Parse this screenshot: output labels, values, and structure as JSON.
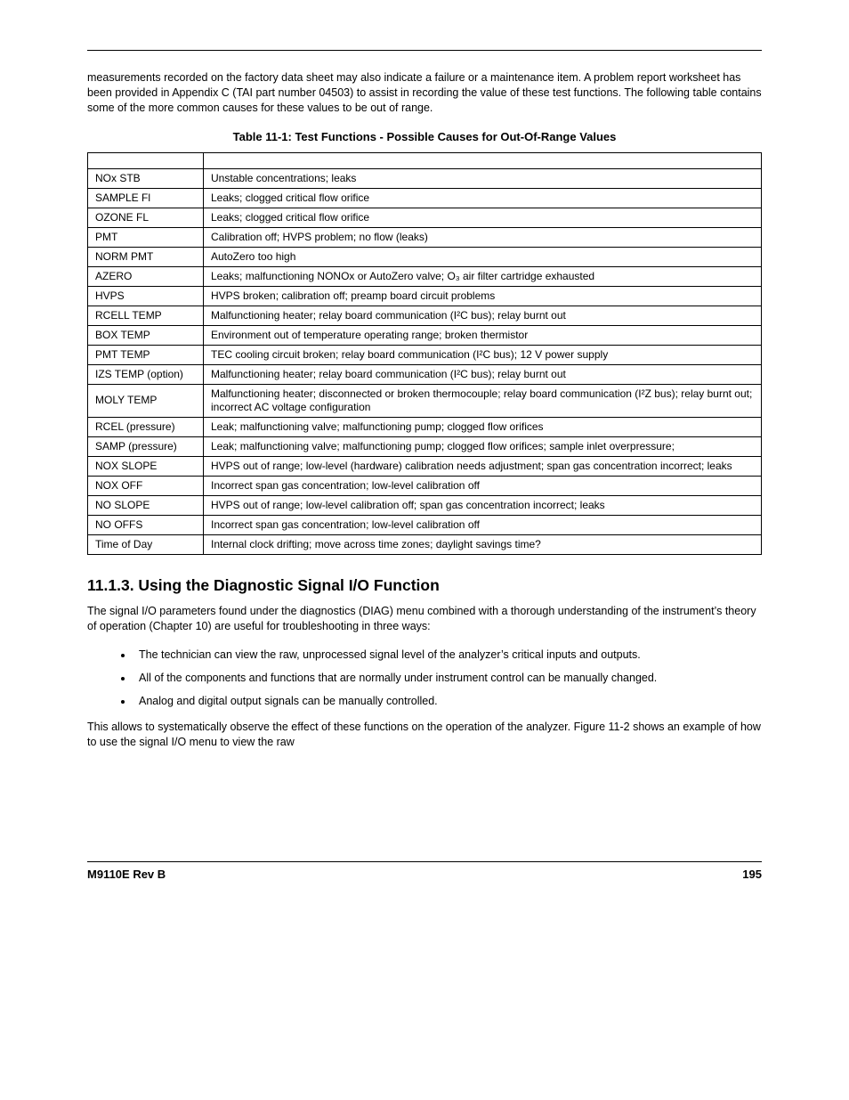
{
  "intro_paragraph": "measurements recorded on the factory data sheet may also indicate a failure or a maintenance item. A problem report worksheet has been provided in Appendix C (TAI part number 04503) to assist in recording the value of these test functions. The following table contains some of the more common causes for these values to be out of range.",
  "table_caption": "Table 11-1:  Test Functions - Possible Causes for Out-Of-Range Values",
  "table_rows": [
    {
      "name": "NOx STB",
      "cause": "Unstable concentrations; leaks"
    },
    {
      "name": "SAMPLE Fl",
      "cause": "Leaks; clogged critical flow orifice"
    },
    {
      "name": "OZONE FL",
      "cause": "Leaks; clogged critical flow orifice"
    },
    {
      "name": "PMT",
      "cause": "Calibration off; HVPS problem; no flow (leaks)"
    },
    {
      "name": "NORM PMT",
      "cause": "AutoZero too high"
    },
    {
      "name": "AZERO",
      "cause": "Leaks; malfunctioning NONOx or AutoZero valve; O₃ air filter cartridge exhausted"
    },
    {
      "name": "HVPS",
      "cause": "HVPS broken; calibration off; preamp board circuit problems"
    },
    {
      "name": "RCELL TEMP",
      "cause": "Malfunctioning heater; relay board communication (I²C bus); relay burnt out"
    },
    {
      "name": "BOX TEMP",
      "cause": "Environment out of temperature operating range; broken thermistor"
    },
    {
      "name": "PMT TEMP",
      "cause": "TEC cooling circuit broken; relay board communication (I²C bus); 12 V power supply"
    },
    {
      "name": "IZS TEMP (option)",
      "cause": "Malfunctioning heater; relay board communication (I²C bus); relay burnt out"
    },
    {
      "name": "MOLY TEMP",
      "cause": "Malfunctioning heater; disconnected or broken thermocouple; relay board communication (I²Z bus); relay burnt out; incorrect AC voltage configuration"
    },
    {
      "name": "RCEL (pressure)",
      "cause": "Leak; malfunctioning valve; malfunctioning pump; clogged flow orifices"
    },
    {
      "name": "SAMP (pressure)",
      "cause": "Leak; malfunctioning valve; malfunctioning pump; clogged flow orifices; sample inlet overpressure;"
    },
    {
      "name": "NOX SLOPE",
      "cause": "HVPS out of range; low-level (hardware) calibration needs adjustment; span gas concentration incorrect; leaks"
    },
    {
      "name": "NOX OFF",
      "cause": "Incorrect span gas concentration; low-level calibration off"
    },
    {
      "name": "NO SLOPE",
      "cause": "HVPS out of range; low-level calibration off; span gas concentration incorrect; leaks"
    },
    {
      "name": "NO OFFS",
      "cause": "Incorrect span gas concentration; low-level calibration off"
    },
    {
      "name": "Time of Day",
      "cause": "Internal clock drifting; move across time zones; daylight savings time?"
    }
  ],
  "section_heading": "11.1.3. Using the Diagnostic Signal I/O Function",
  "diag_para": "The signal I/O parameters found under the diagnostics (DIAG) menu combined with a thorough understanding of the instrument’s theory of operation (Chapter 10) are useful for troubleshooting in three ways:",
  "diag_bullets": [
    "The technician can view the raw, unprocessed signal level of the analyzer’s critical inputs and outputs.",
    "All of the components and functions that are normally under instrument control can be manually changed.",
    "Analog and digital output signals can be manually controlled."
  ],
  "closing_para": "This allows to systematically observe the effect of these functions on the operation of the analyzer. Figure 11-2 shows an example of how to use the signal I/O menu to view the raw",
  "footer_left": "M9110E Rev B",
  "footer_right": "195"
}
